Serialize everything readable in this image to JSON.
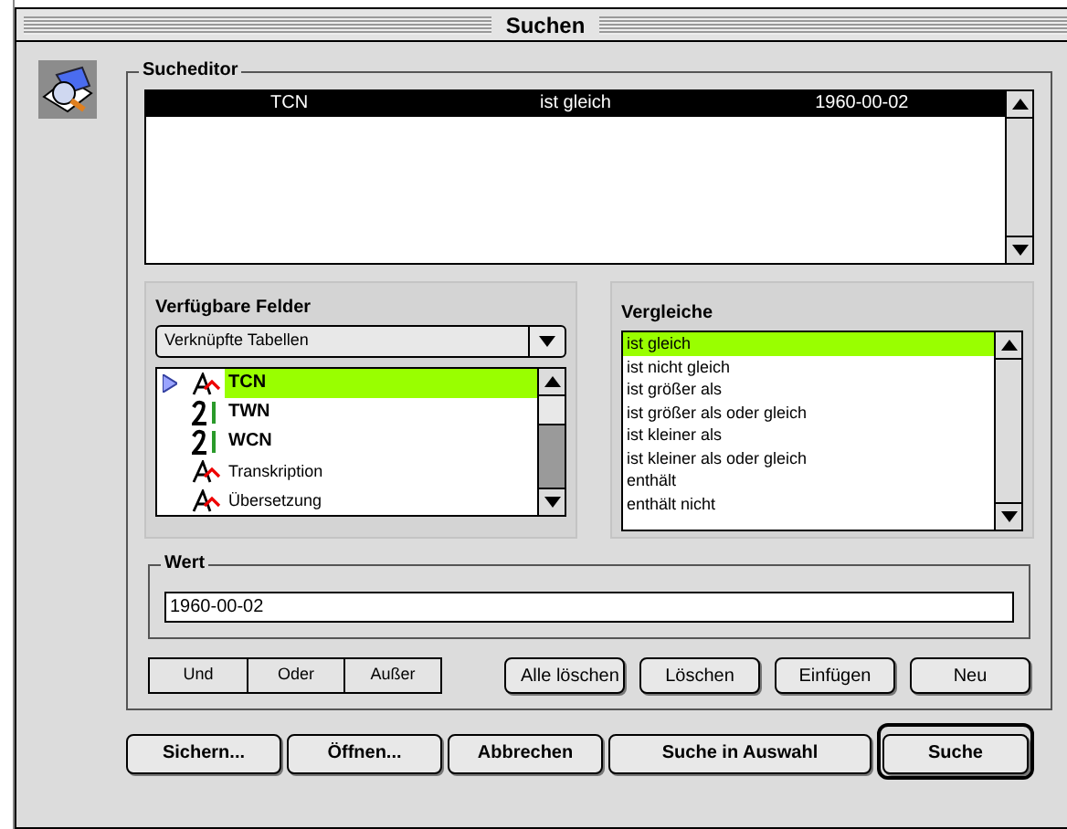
{
  "window": {
    "title": "Suchen"
  },
  "search_editor": {
    "title": "Sucheditor",
    "rows": [
      {
        "field": "TCN",
        "operator": "ist gleich",
        "value": "1960-00-02",
        "selected": true
      }
    ]
  },
  "available_fields": {
    "title": "Verfügbare Felder",
    "dropdown": "Verknüpfte Tabellen",
    "items": [
      {
        "label": "TCN",
        "kind": "text",
        "selected": true,
        "bold": true
      },
      {
        "label": "TWN",
        "kind": "number",
        "selected": false,
        "bold": true
      },
      {
        "label": "WCN",
        "kind": "number",
        "selected": false,
        "bold": true
      },
      {
        "label": "Transkription",
        "kind": "text",
        "selected": false,
        "bold": false
      },
      {
        "label": "Übersetzung",
        "kind": "text",
        "selected": false,
        "bold": false
      }
    ]
  },
  "comparisons": {
    "title": "Vergleiche",
    "items": [
      {
        "label": "ist gleich",
        "selected": true
      },
      {
        "label": "ist nicht gleich",
        "selected": false
      },
      {
        "label": "ist größer als",
        "selected": false
      },
      {
        "label": "ist größer als oder gleich",
        "selected": false
      },
      {
        "label": "ist kleiner als",
        "selected": false
      },
      {
        "label": "ist kleiner als oder gleich",
        "selected": false
      },
      {
        "label": "enthält",
        "selected": false
      },
      {
        "label": "enthält nicht",
        "selected": false
      }
    ]
  },
  "value": {
    "title": "Wert",
    "text": "1960-00-02"
  },
  "logic_buttons": [
    "Und",
    "Oder",
    "Außer"
  ],
  "edit_buttons": [
    "Alle löschen",
    "Löschen",
    "Einfügen",
    "Neu"
  ],
  "dialog_buttons": [
    {
      "label": "Sichern...",
      "default": false
    },
    {
      "label": "Öffnen...",
      "default": false
    },
    {
      "label": "Abbrechen",
      "default": false
    },
    {
      "label": "Suche in Auswahl",
      "default": false
    },
    {
      "label": "Suche",
      "default": true
    }
  ]
}
